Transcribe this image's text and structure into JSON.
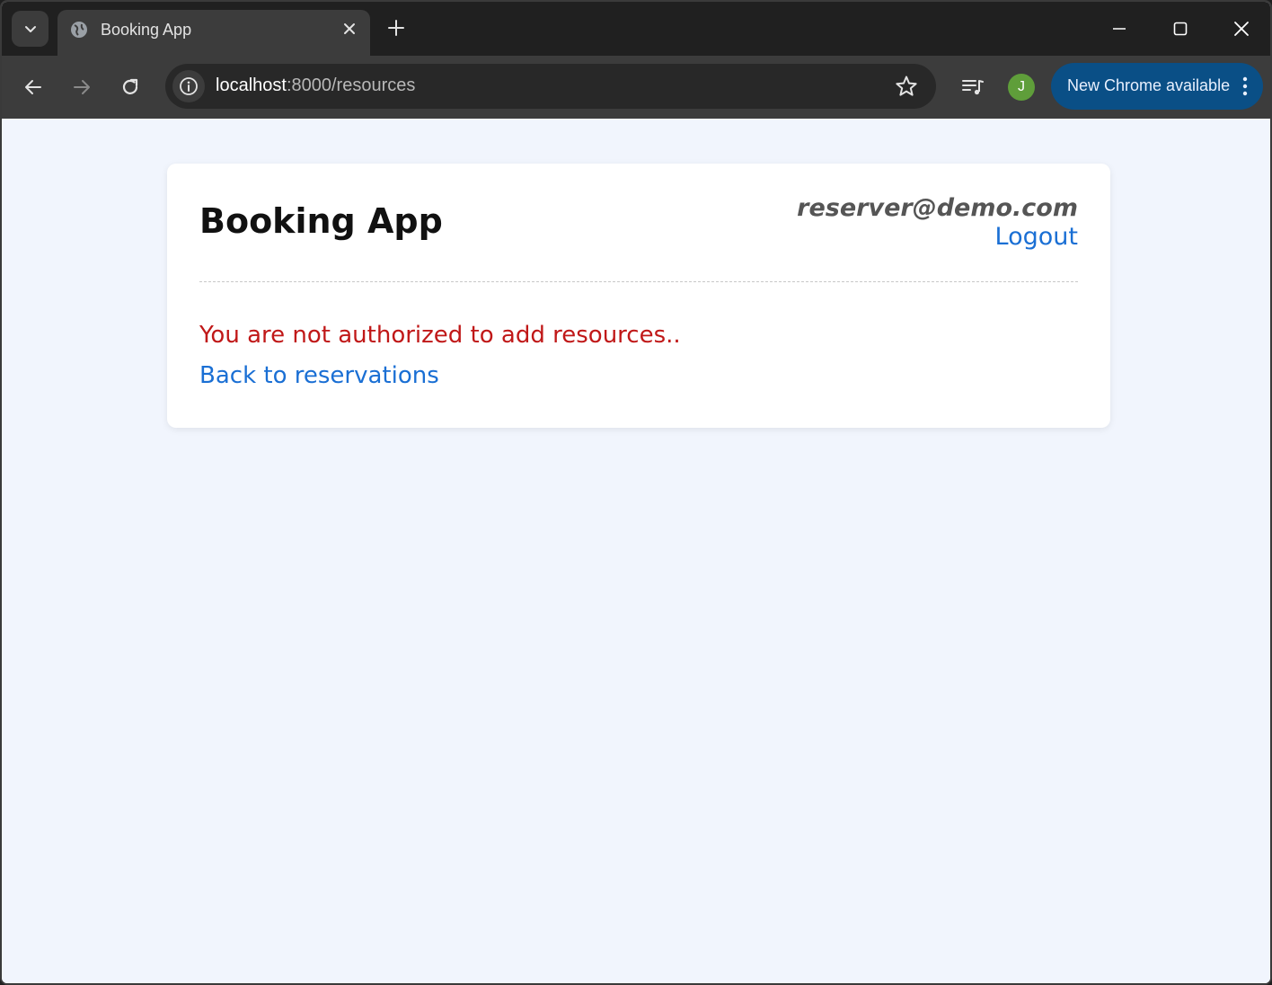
{
  "browser": {
    "tab": {
      "title": "Booking App"
    },
    "url": {
      "host": "localhost",
      "path": ":8000/resources"
    },
    "profile_initial": "J",
    "update_button_label": "New Chrome available",
    "colors": {
      "frame": "#202020",
      "toolbar": "#3c3c3c",
      "update_button": "#0a4f86",
      "avatar": "#5f9e3a"
    }
  },
  "page": {
    "app_title": "Booking App",
    "user_email": "reserver@demo.com",
    "logout_label": "Logout",
    "error_message": "You are not authorized to add resources..",
    "back_link_label": "Back to reservations",
    "colors": {
      "background": "#f1f5fd",
      "error": "#c01818",
      "link": "#1a6fd4"
    }
  }
}
